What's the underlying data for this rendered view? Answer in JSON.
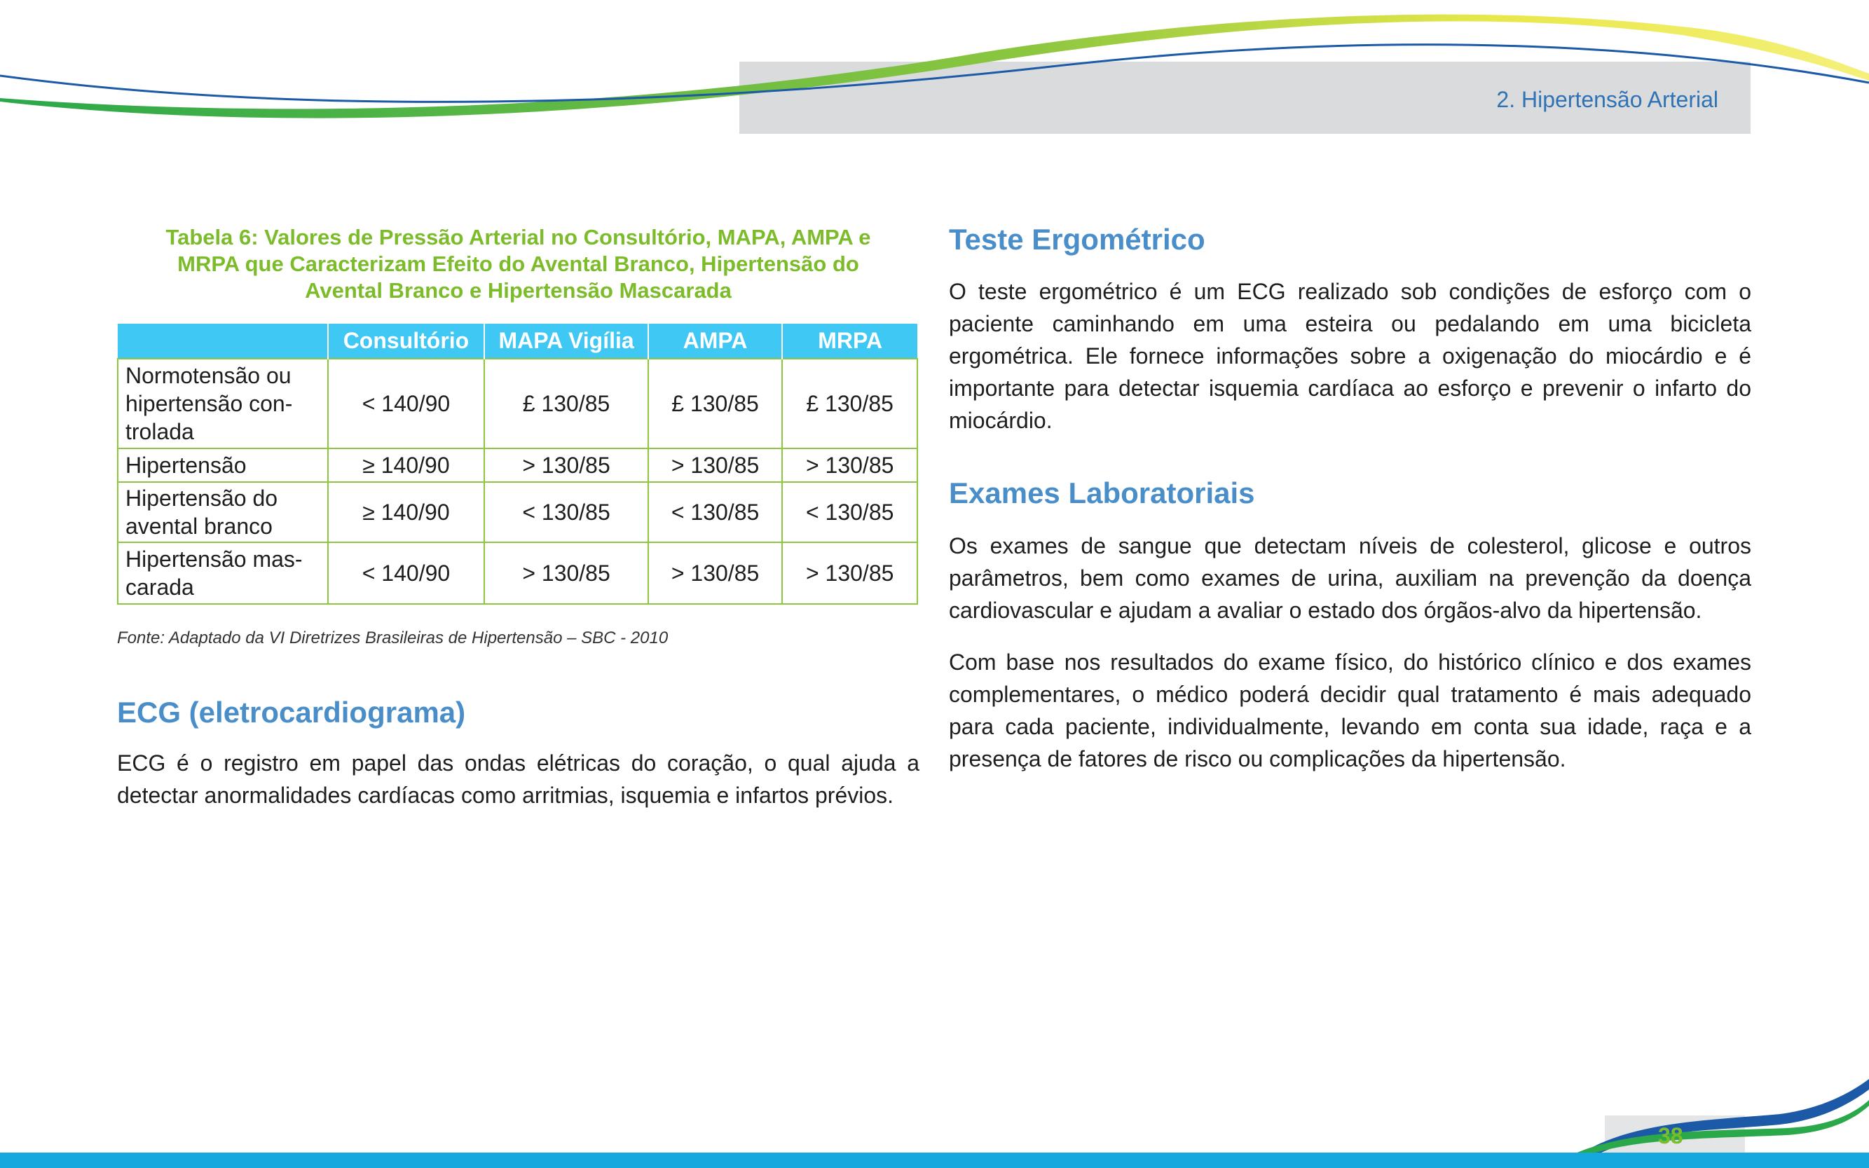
{
  "header": {
    "section_label": "2. Hipertensão Arterial"
  },
  "table": {
    "caption": "Tabela 6: Valores de Pressão Arterial no Consultório, MAPA, AMPA e MRPA que Caracterizam Efeito do Avental Branco, Hipertensão do Avental Branco e Hipertensão Mascarada",
    "columns": [
      "",
      "Consultório",
      "MAPA Vigília",
      "AMPA",
      "MRPA"
    ],
    "rows": [
      [
        "Normotensão ou hipertensão con-trolada",
        "< 140/90",
        "£ 130/85",
        "£ 130/85",
        "£ 130/85"
      ],
      [
        "Hipertensão",
        "≥ 140/90",
        "> 130/85",
        "> 130/85",
        "> 130/85"
      ],
      [
        "Hipertensão do avental branco",
        "≥ 140/90",
        "< 130/85",
        "< 130/85",
        "< 130/85"
      ],
      [
        "Hipertensão mas-carada",
        "< 140/90",
        "> 130/85",
        "> 130/85",
        "> 130/85"
      ]
    ],
    "source": "Fonte: Adaptado da VI Diretrizes Brasileiras de Hipertensão – SBC - 2010"
  },
  "ecg": {
    "heading": "ECG (eletrocardiograma)",
    "text": "ECG é o registro em papel das ondas elétricas do coração, o qual ajuda a detectar anormalidades cardíacas como arritmias, isquemia e infartos prévios."
  },
  "teste": {
    "heading": "Teste Ergométrico",
    "text": "O teste ergométrico é um ECG realizado sob condições de esforço com o paciente caminhando em uma esteira ou pedalando em uma bicicleta ergométrica. Ele fornece informações sobre a oxigenação do miocárdio e é importante para detectar isquemia cardíaca ao esforço e prevenir o infarto do miocárdio."
  },
  "exames": {
    "heading": "Exames Laboratoriais",
    "text1": "Os exames de sangue que detectam níveis de colesterol, glicose e outros parâmetros, bem como exames de urina, auxiliam na prevenção da doença cardiovascular e ajudam a avaliar o estado dos órgãos-alvo da hipertensão.",
    "text2": "Com base nos resultados do exame físico, do histórico clínico e dos exames complementares, o médico poderá decidir qual tratamento é mais adequado para cada paciente, individualmente, levando em conta sua idade, raça e a presença de fatores de risco ou complicações da hipertensão."
  },
  "footer": {
    "page_number": "38"
  },
  "colors": {
    "accent_blue": "#4a8ec9",
    "accent_green": "#7cbc2b",
    "table_header": "#3ec8f3",
    "table_border": "#8dc63f"
  }
}
